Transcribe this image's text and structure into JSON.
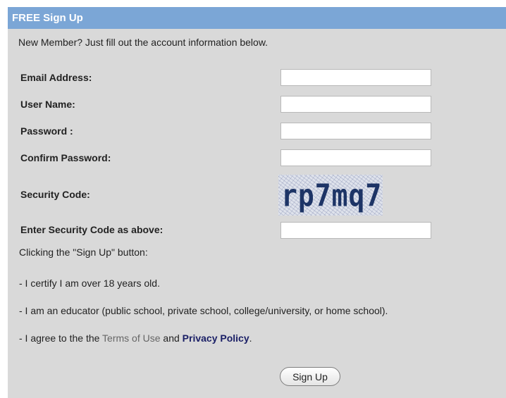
{
  "form": {
    "title": "FREE Sign Up",
    "intro": "New Member? Just fill out the account information below.",
    "fields": {
      "email_label": "Email Address:",
      "email_value": "",
      "username_label": "User Name:",
      "username_value": "",
      "password_label": "Password :",
      "password_value": "",
      "confirm_label": "Confirm Password:",
      "confirm_value": "",
      "security_label": "Security Code:",
      "security_code": "rp7mq7",
      "enter_code_label": "Enter Security Code as above:",
      "enter_code_value": ""
    },
    "notes": {
      "clicking": "Clicking the \"Sign Up\" button:",
      "certify": "- I certify I am over 18 years old.",
      "educator": "- I am an educator (public school, private school, college/university, or home school).",
      "agree_prefix": "- I agree to the the",
      "terms_link": "Terms of Use",
      "and": "and",
      "privacy_link": "Privacy Policy",
      "period": "."
    },
    "submit_label": "Sign Up"
  }
}
